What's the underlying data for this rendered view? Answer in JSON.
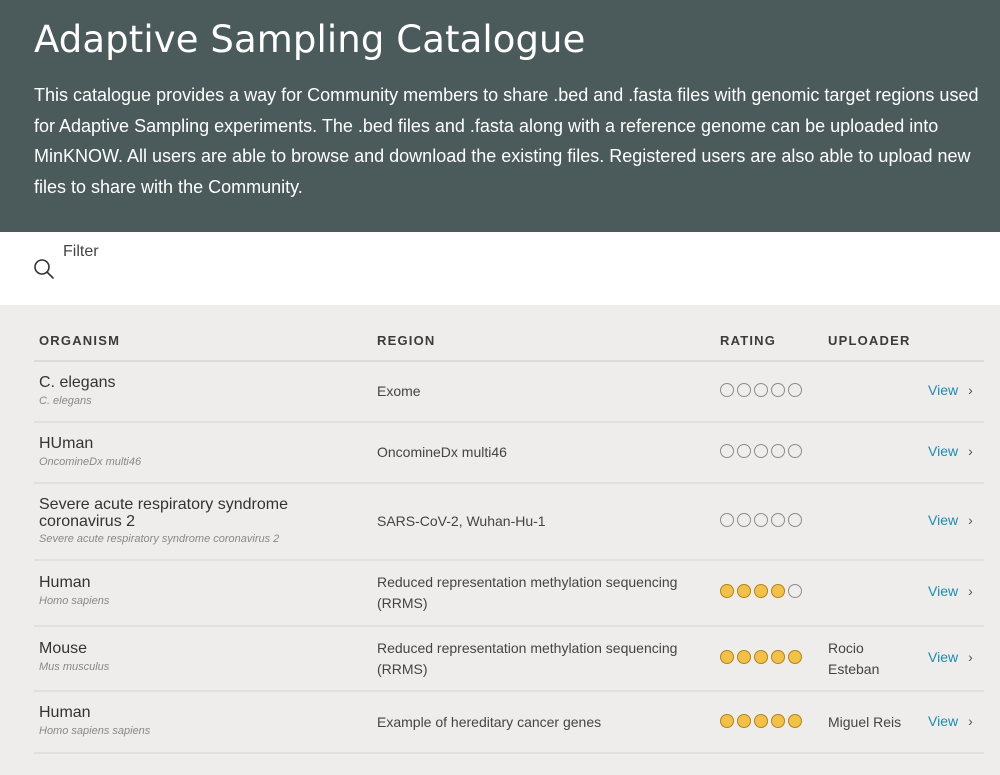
{
  "header": {
    "title": "Adaptive Sampling Catalogue",
    "description": "This catalogue provides a way for Community members to share .bed and .fasta files with genomic target regions used for Adaptive Sampling experiments. The .bed files and .fasta along with a reference genome can be uploaded into MinKNOW. All users are able to browse and download the existing files. Registered users are also able to upload new files to share with the Community."
  },
  "filter": {
    "label": "Filter",
    "icon": "search-icon"
  },
  "table": {
    "columns": {
      "organism": "ORGANISM",
      "region": "REGION",
      "rating": "RATING",
      "uploader": "UPLOADER"
    },
    "view_label": "View",
    "rows": [
      {
        "organism": "C. elegans",
        "scientific": "C. elegans",
        "region": "Exome",
        "rating": 0,
        "uploader": ""
      },
      {
        "organism": "HUman",
        "scientific": "OncomineDx multi46",
        "region": "OncomineDx multi46",
        "rating": 0,
        "uploader": ""
      },
      {
        "organism": "Severe acute respiratory syndrome coronavirus 2",
        "scientific": "Severe acute respiratory syndrome coronavirus 2",
        "region": "SARS-CoV-2, Wuhan-Hu-1",
        "rating": 0,
        "uploader": ""
      },
      {
        "organism": "Human",
        "scientific": "Homo sapiens",
        "region": "Reduced representation methylation sequencing (RRMS)",
        "rating": 4,
        "uploader": ""
      },
      {
        "organism": "Mouse",
        "scientific": "Mus musculus",
        "region": "Reduced representation methylation sequencing (RRMS)",
        "rating": 5,
        "uploader": "Rocio Esteban"
      },
      {
        "organism": "Human",
        "scientific": "Homo sapiens sapiens",
        "region": "Example of hereditary cancer genes",
        "rating": 5,
        "uploader": "Miguel Reis"
      }
    ]
  },
  "colors": {
    "header_bg": "#4b5b5c",
    "link": "#1d8bb0",
    "star_filled": "#f2c14a",
    "page_bg": "#eeedeb"
  }
}
